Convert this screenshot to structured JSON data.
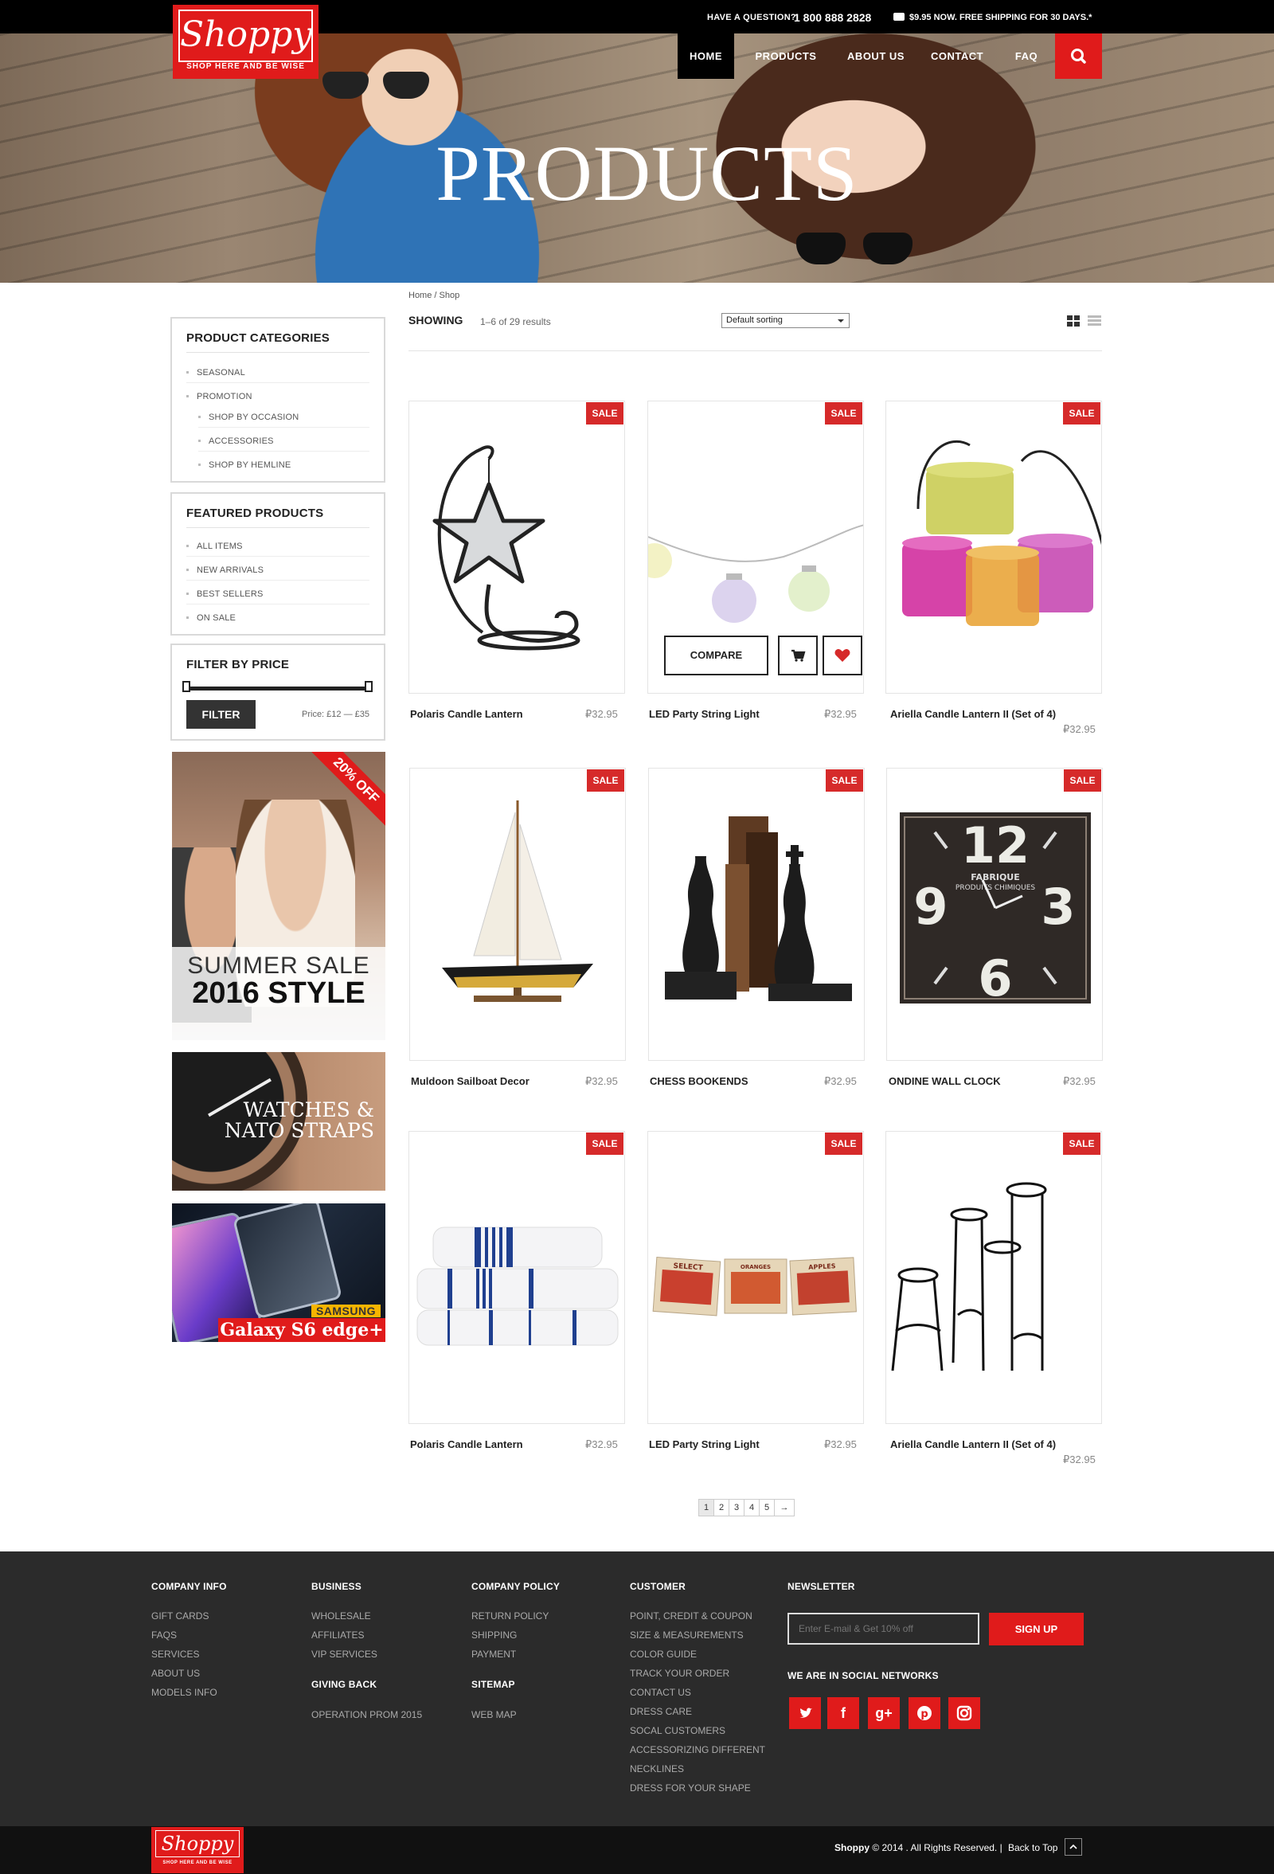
{
  "topbar": {
    "question": "HAVE A QUESTION?",
    "phone": "1 800 888 2828",
    "shipping": "$9.95 NOW. FREE SHIPPING FOR 30 DAYS.*"
  },
  "logo": {
    "name": "Shoppy",
    "tagline": "SHOP HERE AND BE WISE"
  },
  "nav": [
    "HOME",
    "PRODUCTS",
    "ABOUT US",
    "CONTACT",
    "FAQ"
  ],
  "hero": {
    "title": "PRODUCTS"
  },
  "breadcrumb": "Home / Shop",
  "toolbar": {
    "showing": "SHOWING",
    "results": "1–6 of 29 results",
    "sort": "Default sorting"
  },
  "sidebar": {
    "categories": {
      "title": "PRODUCT CATEGORIES",
      "items": [
        "SEASONAL",
        "PROMOTION",
        "SHOP BY OCCASION",
        "ACCESSORIES",
        "SHOP BY HEMLINE"
      ]
    },
    "featured": {
      "title": "FEATURED PRODUCTS",
      "items": [
        "ALL ITEMS",
        "NEW ARRIVALS",
        "BEST SELLERS",
        "ON SALE"
      ]
    },
    "filter": {
      "title": "FILTER BY PRICE",
      "button": "FILTER",
      "price": "Price: £12 — £35"
    },
    "banners": {
      "summer": {
        "ribbon": "20% OFF",
        "line1": "SUMMER SALE",
        "line2": "2016 STYLE"
      },
      "watches": {
        "line1": "WATCHES &",
        "line2": "NATO STRAPS"
      },
      "galaxy": {
        "brand": "SAMSUNG",
        "model": "Galaxy S6 edge+"
      }
    }
  },
  "products": [
    {
      "name": "Polaris Candle Lantern",
      "price": "₽32.95",
      "badge": "SALE"
    },
    {
      "name": "LED Party String Light",
      "price": "₽32.95",
      "badge": "SALE"
    },
    {
      "name": "Ariella Candle Lantern II  (Set of 4)",
      "price": "₽32.95",
      "badge": "SALE"
    },
    {
      "name": "Muldoon Sailboat Decor",
      "price": "₽32.95",
      "badge": "SALE"
    },
    {
      "name": "CHESS BOOKENDS",
      "price": "₽32.95",
      "badge": "SALE"
    },
    {
      "name": "ONDINE WALL CLOCK",
      "price": "₽32.95",
      "badge": "SALE"
    },
    {
      "name": "Polaris Candle Lantern",
      "price": "₽32.95",
      "badge": "SALE"
    },
    {
      "name": "LED Party String Light",
      "price": "₽32.95",
      "badge": "SALE"
    },
    {
      "name": "Ariella Candle Lantern II  (Set of 4)",
      "price": "₽32.95",
      "badge": "SALE"
    }
  ],
  "hover": {
    "compare": "COMPARE"
  },
  "clock": {
    "n12": "12",
    "n3": "3",
    "n6": "6",
    "n9": "9",
    "label1": "FABRIQUE",
    "label2": "PRODUITS CHIMIQUES"
  },
  "crates": [
    "SELECT",
    "ORANGES",
    "APPLES"
  ],
  "pagination": [
    "1",
    "2",
    "3",
    "4",
    "5",
    "→"
  ],
  "footer": {
    "company": {
      "title": "COMPANY INFO",
      "links": [
        "GIFT CARDS",
        "FAQS",
        "SERVICES",
        "ABOUT US",
        "MODELS INFO"
      ]
    },
    "business": {
      "title": "BUSINESS",
      "links": [
        "WHOLESALE",
        "AFFILIATES",
        "VIP SERVICES"
      ]
    },
    "giving": {
      "title": "GIVING BACK",
      "links": [
        "OPERATION PROM 2015"
      ]
    },
    "policy": {
      "title": "COMPANY POLICY",
      "links": [
        "RETURN POLICY",
        "SHIPPING",
        "PAYMENT"
      ]
    },
    "sitemap": {
      "title": "SITEMAP",
      "links": [
        "WEB MAP"
      ]
    },
    "customer": {
      "title": "CUSTOMER",
      "links": [
        "POINT, CREDIT & COUPON",
        "SIZE & MEASUREMENTS",
        "COLOR GUIDE",
        "TRACK YOUR ORDER",
        "CONTACT US",
        "DRESS CARE",
        "SOCAL CUSTOMERS",
        "ACCESSORIZING DIFFERENT",
        "NECKLINES",
        "DRESS FOR YOUR SHAPE"
      ]
    },
    "newsletter": {
      "title": "NEWSLETTER",
      "placeholder": "Enter E-mail & Get 10% off",
      "button": "SIGN UP"
    },
    "social": {
      "title": "WE ARE IN SOCIAL NETWORKS",
      "icons": [
        "twitter-icon",
        "facebook-icon",
        "google-plus-icon",
        "pinterest-icon",
        "instagram-icon"
      ]
    },
    "brand": "Shoppy",
    "copyright": " © 2014 . All Rights Reserved. |",
    "back_to_top": "Back to Top"
  },
  "colors": {
    "accent": "#e01b1b",
    "dark": "#2b2b2b",
    "black": "#000000"
  }
}
